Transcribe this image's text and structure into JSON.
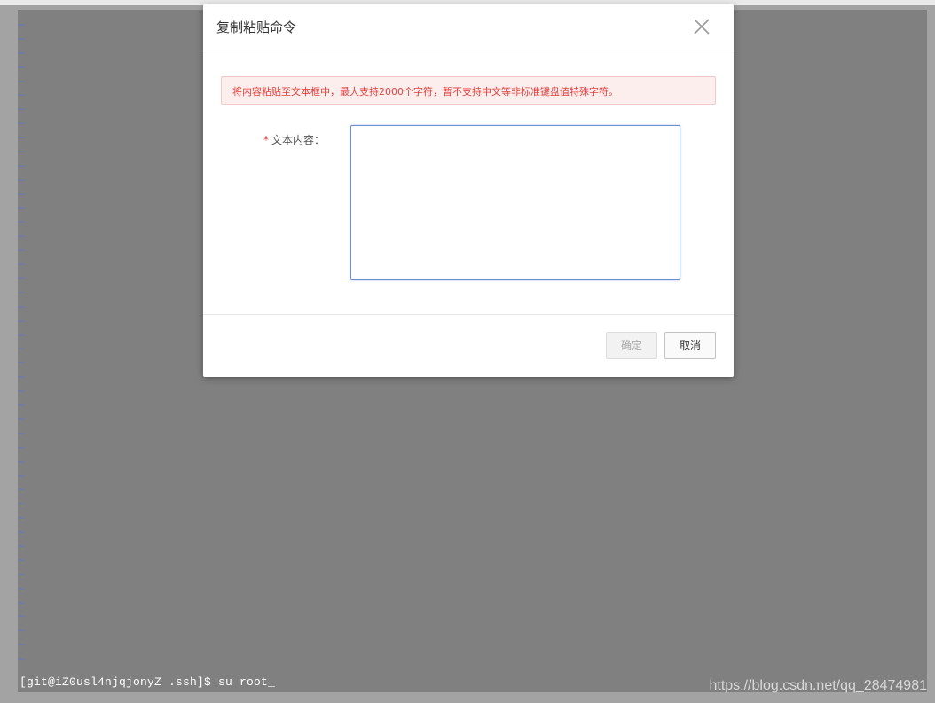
{
  "dialog": {
    "title": "复制粘贴命令",
    "close_icon": "close-icon",
    "alert_text": "将内容粘贴至文本框中，最大支持2000个字符，暂不支持中文等非标准键盘值特殊字符。",
    "field": {
      "required_mark": "*",
      "label": "文本内容：",
      "value": "",
      "placeholder": ""
    },
    "confirm_label": "确定",
    "cancel_label": "取消"
  },
  "terminal": {
    "tilde": "~",
    "prompt": "[git@iZ0usl4njqjonyZ .ssh]$ su root_"
  },
  "watermark": "https://blog.csdn.net/qq_28474981",
  "colors": {
    "terminal_bg": "#808080",
    "tilde": "#6a74c8",
    "alert_text": "#e0403c",
    "alert_bg": "#fdeeee",
    "focus_border": "#6c8fd4"
  }
}
